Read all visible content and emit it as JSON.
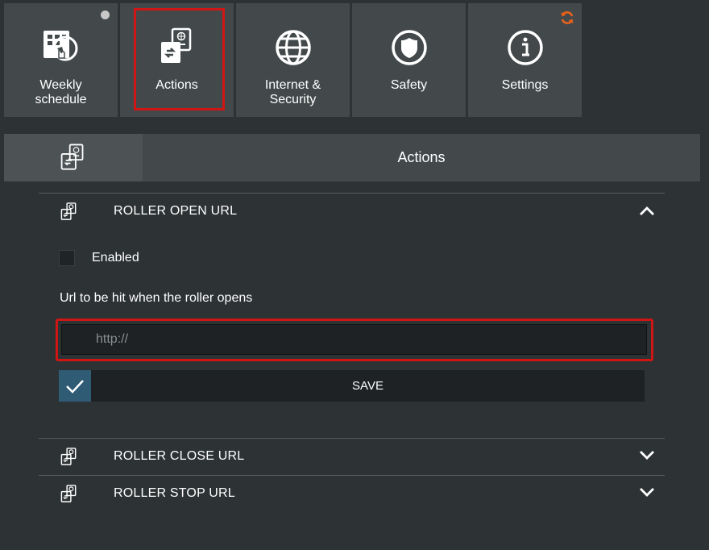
{
  "tabs": [
    {
      "label_1": "Weekly",
      "label_2": "schedule",
      "icon": "weekly-schedule-icon",
      "badge": "dot"
    },
    {
      "label": "Actions",
      "icon": "actions-icon",
      "selected": true
    },
    {
      "label_1": "Internet &",
      "label_2": "Security",
      "icon": "globe-icon"
    },
    {
      "label": "Safety",
      "icon": "shield-icon"
    },
    {
      "label": "Settings",
      "icon": "info-icon",
      "badge": "sync-icon"
    }
  ],
  "header": {
    "title": "Actions",
    "icon": "actions-icon"
  },
  "sections": [
    {
      "title": "ROLLER OPEN URL",
      "expanded": true,
      "chevron": "chevron-up-icon"
    },
    {
      "title": "ROLLER CLOSE URL",
      "expanded": false,
      "chevron": "chevron-down-icon"
    },
    {
      "title": "ROLLER STOP URL",
      "expanded": false,
      "chevron": "chevron-down-icon"
    }
  ],
  "form": {
    "enabled_label": "Enabled",
    "enabled_checked": false,
    "url_label": "Url to be hit when the roller opens",
    "url_value": "",
    "url_placeholder": "http://",
    "save_label": "SAVE"
  },
  "colors": {
    "accent": "#d01515",
    "sync": "#e8611a",
    "save_check": "#2f5b75",
    "tile": "#43494b",
    "background": "#2d3234"
  }
}
